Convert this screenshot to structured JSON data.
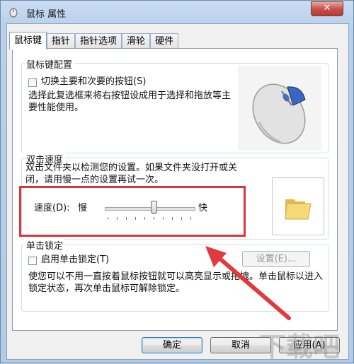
{
  "window": {
    "title": "鼠标 属性",
    "close_label": "✕"
  },
  "tabs": [
    "鼠标键",
    "指针",
    "指针选项",
    "滑轮",
    "硬件"
  ],
  "button_config": {
    "group_title": "鼠标键配置",
    "checkbox_label": "切换主要和次要的按钮(S)",
    "checked": false,
    "description": "选择此复选框来将右按钮设成用于选择和拖放等主要性能使用。"
  },
  "double_click": {
    "group_title": "双击速度",
    "description": "双击文件夹以检测您的设置。如果文件夹没打开或关闭，请用慢一点的设置再试一次。",
    "speed_label": "速度(D):",
    "slow_label": "慢",
    "fast_label": "快",
    "speed_level": 0.55
  },
  "click_lock": {
    "group_title": "单击锁定",
    "checkbox_label": "启用单击锁定(T)",
    "checked": false,
    "settings_label": "设置(E)...",
    "description": "使您可以不用一直按着鼠标按钮就可以高亮显示或拖拽。单击鼠标以进入锁定状态，再次单击鼠标可解除锁定。"
  },
  "footer": {
    "ok_label": "确定",
    "cancel_label": "取消",
    "apply_label": "应用(A)"
  },
  "watermark": "下载吧",
  "colors": {
    "highlight_box": "#d9363e",
    "arrow": "#e03a3e",
    "folder": "#f3d56a"
  }
}
